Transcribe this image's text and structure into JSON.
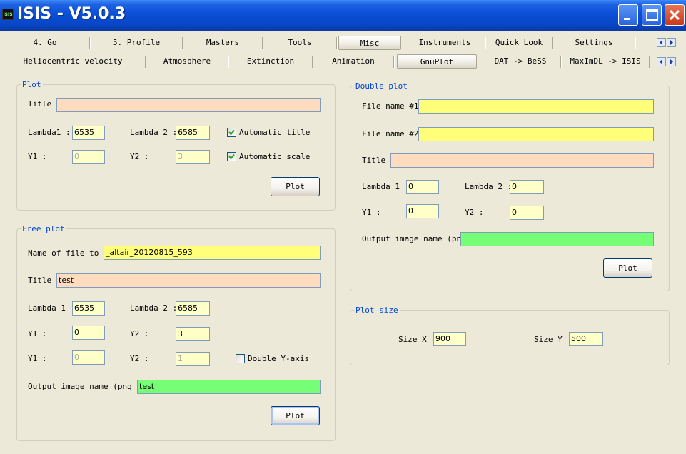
{
  "window": {
    "title": "ISIS - V5.0.3",
    "icon_label": "ISIS"
  },
  "tabs_row1": [
    {
      "label": "4. Go"
    },
    {
      "label": "5. Profile"
    },
    {
      "label": "Masters"
    },
    {
      "label": "Tools"
    },
    {
      "label": "Misc"
    },
    {
      "label": "Instruments"
    },
    {
      "label": "Quick Look"
    },
    {
      "label": "Settings"
    }
  ],
  "tabs_row2": [
    {
      "label": "Heliocentric velocity"
    },
    {
      "label": "Atmosphere"
    },
    {
      "label": "Extinction"
    },
    {
      "label": "Animation"
    },
    {
      "label": "GnuPlot"
    },
    {
      "label": "DAT -> BeSS"
    },
    {
      "label": "MaxImDL -> ISIS"
    }
  ],
  "plot": {
    "title": "Plot",
    "title_label": "Title :",
    "title_value": "",
    "lambda1_label": "Lambda1 :",
    "lambda1_value": "6535",
    "lambda2_label": "Lambda 2 :",
    "lambda2_value": "6585",
    "y1_label": "Y1 :",
    "y1_value": "0",
    "y2_label": "Y2 :",
    "y2_value": "3",
    "auto_title_label": "Automatic title",
    "auto_title_checked": true,
    "auto_scale_label": "Automatic scale",
    "auto_scale_checked": true,
    "plot_button": "Plot"
  },
  "free_plot": {
    "title": "Free plot",
    "file_label": "Name of file to pl",
    "file_value": "_altair_20120815_593",
    "title_label": "Title :",
    "title_value": "test",
    "lambda1_label": "Lambda 1 :",
    "lambda1_value": "6535",
    "lambda2_label": "Lambda 2 :",
    "lambda2_value": "6585",
    "y1_label": "Y1 :",
    "y1_value": "0",
    "y2_label": "Y2 :",
    "y2_value": "3",
    "y1b_label": "Y1 :",
    "y1b_value": "0",
    "y2b_label": "Y2 :",
    "y2b_value": "1",
    "double_y_label": "Double Y-axis",
    "double_y_checked": false,
    "output_label": "Output image name (png fil",
    "output_value": "test",
    "plot_button": "Plot"
  },
  "double_plot": {
    "title": "Double plot",
    "file1_label": "File name #1",
    "file1_value": "",
    "file2_label": "File name #2",
    "file2_value": "",
    "title_label": "Title :",
    "title_value": "",
    "lambda1_label": "Lambda 1 :",
    "lambda1_value": "0",
    "lambda2_label": "Lambda 2 :",
    "lambda2_value": "0",
    "y1_label": "Y1 :",
    "y1_value": "0",
    "y2_label": "Y2 :",
    "y2_value": "0",
    "output_label": "Output image name (png)",
    "output_value": "",
    "plot_button": "Plot"
  },
  "plot_size": {
    "title": "Plot size",
    "sizex_label": "Size X :",
    "sizex_value": "900",
    "sizey_label": "Size Y :",
    "sizey_value": "500"
  },
  "colors": {
    "titlebar": "#0a4fd6",
    "group_title": "#0046d5",
    "field_peach": "#ffdbbf",
    "field_yellow": "#ffff7a",
    "field_green": "#76ff76"
  }
}
